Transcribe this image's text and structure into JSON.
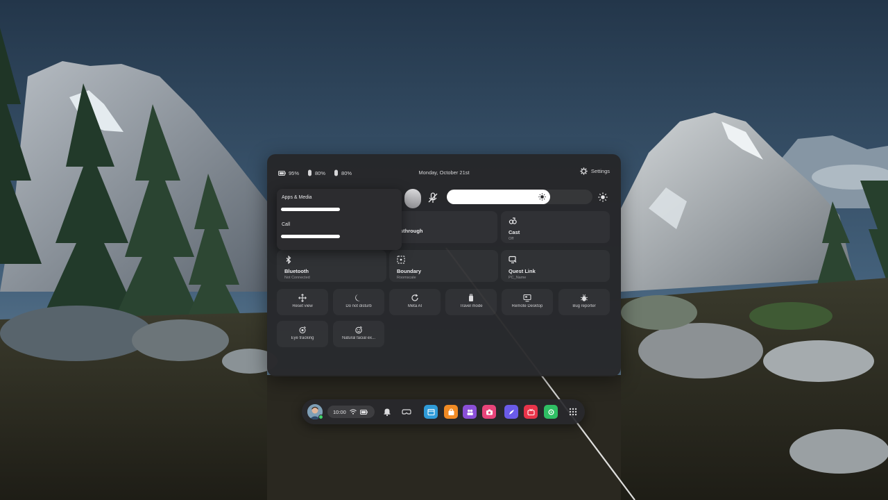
{
  "status": {
    "headset_battery": "95%",
    "left_controller_battery": "80%",
    "right_controller_battery": "80%",
    "date": "Monday, October 21st",
    "settings_label": "Settings"
  },
  "volume_popup": {
    "apps_media_label": "Apps & Media",
    "call_label": "Call",
    "apps_media_level": 0.47,
    "call_level": 0.47
  },
  "brightness_level": 0.71,
  "tiles": {
    "passthrough": {
      "label": "sthrough"
    },
    "cast": {
      "label": "Cast",
      "sub": "Off"
    },
    "bluetooth": {
      "label": "Bluetooth",
      "sub": "Not Connected"
    },
    "boundary": {
      "label": "Boundary",
      "sub": "Roomscale"
    },
    "quest_link": {
      "label": "Quest Link",
      "sub": "PC_Name"
    }
  },
  "small_tiles": [
    {
      "label": "Reset view",
      "icon": "move-icon"
    },
    {
      "label": "Do not disturb",
      "icon": "moon-icon"
    },
    {
      "label": "Meta AI",
      "icon": "refresh-icon"
    },
    {
      "label": "Travel mode",
      "icon": "travel-icon"
    },
    {
      "label": "Remote Desktop",
      "icon": "monitor-icon"
    },
    {
      "label": "Bug reporter",
      "icon": "bug-icon"
    },
    {
      "label": "Eye tracking",
      "icon": "eye-icon"
    },
    {
      "label": "Natural facial ex...",
      "icon": "face-icon"
    }
  ],
  "dock": {
    "time": "10:00",
    "apps": [
      {
        "name": "browser-app",
        "color": "#2f9bd8"
      },
      {
        "name": "store-app",
        "color": "#f08a24"
      },
      {
        "name": "people-app",
        "color": "#8a4fd8"
      },
      {
        "name": "camera-app",
        "color": "#e8447a"
      },
      {
        "name": "horizon-app",
        "color": "#6a5be8"
      },
      {
        "name": "tv-app",
        "color": "#e8344a"
      },
      {
        "name": "settings-app",
        "color": "#2fbf64"
      }
    ]
  }
}
